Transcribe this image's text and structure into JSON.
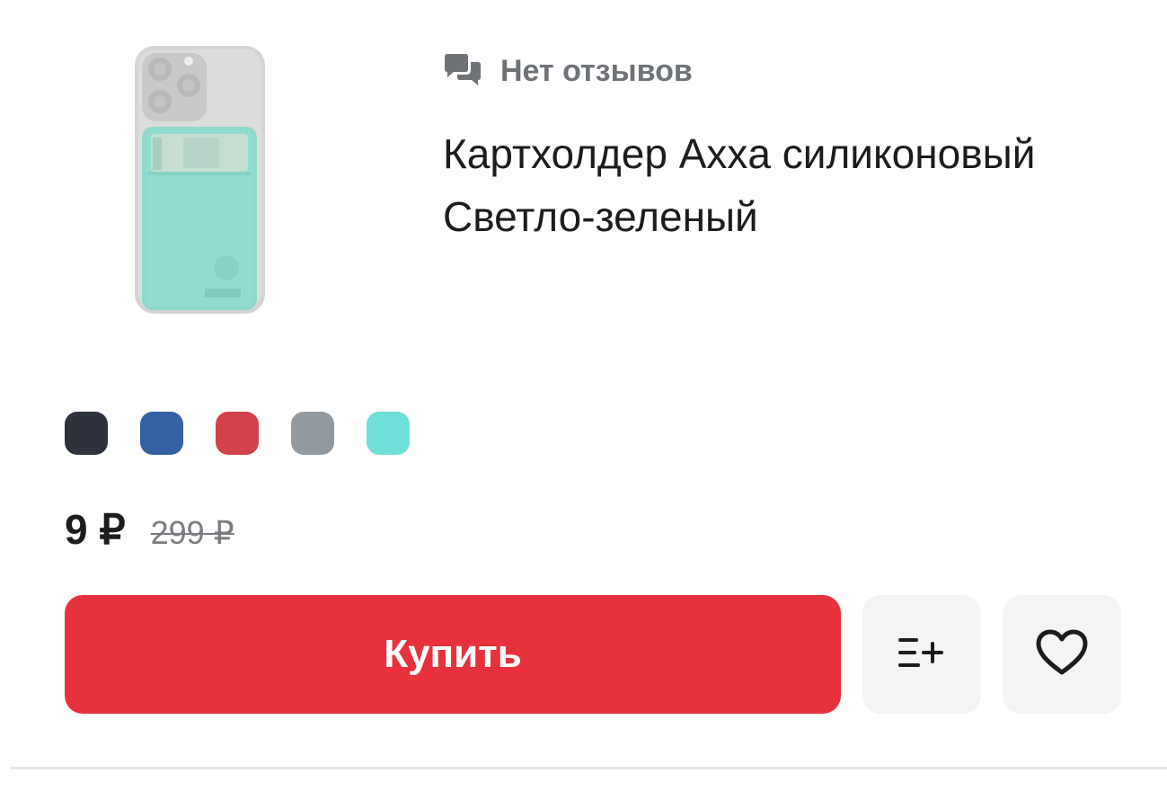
{
  "product": {
    "reviews_label": "Нет отзывов",
    "title_line1": "Картхолдер Axxa силиконовый",
    "title_line2": "Светло-зеленый",
    "image_icon": "phone-cardholder-image"
  },
  "colors": [
    {
      "name": "dark",
      "hex": "#2d323c"
    },
    {
      "name": "blue",
      "hex": "#3460a4"
    },
    {
      "name": "red",
      "hex": "#d2424a"
    },
    {
      "name": "gray",
      "hex": "#929a9f"
    },
    {
      "name": "mint",
      "hex": "#6ee0d8"
    }
  ],
  "pricing": {
    "price": "9 ₽",
    "old_price": "299 ₽"
  },
  "actions": {
    "buy_label": "Купить",
    "compare_icon": "add-to-list-icon",
    "favorite_icon": "heart-icon"
  },
  "theme": {
    "accent": "#e7323e",
    "muted": "#6f7378",
    "text": "#1c1c1c"
  }
}
